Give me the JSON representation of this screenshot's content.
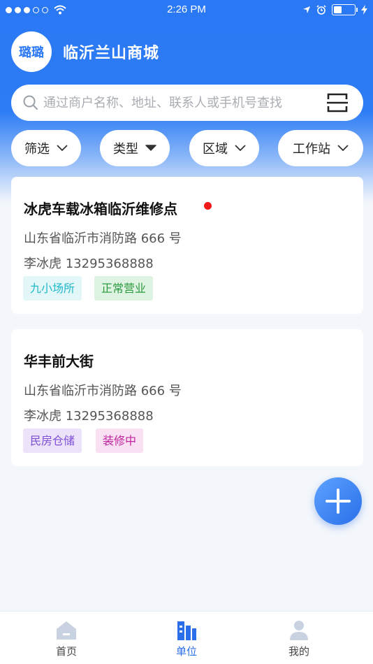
{
  "status_bar": {
    "time": "2:26 PM"
  },
  "app": {
    "logo_text": "璐璐",
    "title": "临沂兰山商城"
  },
  "search": {
    "placeholder": "通过商户名称、地址、联系人或手机号查找"
  },
  "filters": [
    {
      "label": "筛选",
      "icon": "chevron-down-icon"
    },
    {
      "label": "类型",
      "icon": "caret-down-icon"
    },
    {
      "label": "区域",
      "icon": "chevron-down-icon"
    },
    {
      "label": "工作站",
      "icon": "chevron-down-icon"
    }
  ],
  "cards": [
    {
      "title": "冰虎车载冰箱临沂维修点",
      "unread_dot": true,
      "address": "山东省临沂市消防路 666 号",
      "contact": "李冰虎 13295368888",
      "tags": [
        {
          "label": "九小场所",
          "color": "#20b9c9",
          "bg": "#e3f6f8"
        },
        {
          "label": "正常营业",
          "color": "#2a9a3e",
          "bg": "#dff3e2"
        }
      ]
    },
    {
      "title": "华丰前大街",
      "unread_dot": false,
      "address": "山东省临沂市消防路 666 号",
      "contact": "李冰虎 13295368888",
      "tags": [
        {
          "label": "民房仓储",
          "color": "#7e4fd6",
          "bg": "#ece3fb"
        },
        {
          "label": "装修中",
          "color": "#c0239e",
          "bg": "#fae0f3"
        }
      ]
    }
  ],
  "tabbar": [
    {
      "label": "首页",
      "icon": "home-icon",
      "active": false
    },
    {
      "label": "单位",
      "icon": "buildings-icon",
      "active": true
    },
    {
      "label": "我的",
      "icon": "user-icon",
      "active": false
    }
  ],
  "colors": {
    "primary": "#2a78f4",
    "active_tab": "#2a6fe9",
    "inactive_icon": "#c9d2e0"
  }
}
